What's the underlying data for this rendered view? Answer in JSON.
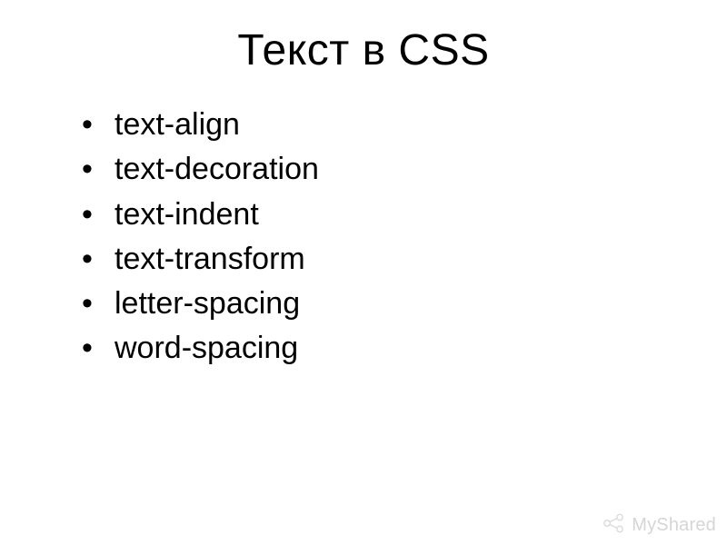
{
  "slide": {
    "title": "Текст в CSS",
    "bullets": [
      "text-align",
      "text-decoration",
      "text-indent",
      "text-transform",
      "letter-spacing",
      "word-spacing"
    ]
  },
  "watermark": {
    "text": "MyShared"
  }
}
